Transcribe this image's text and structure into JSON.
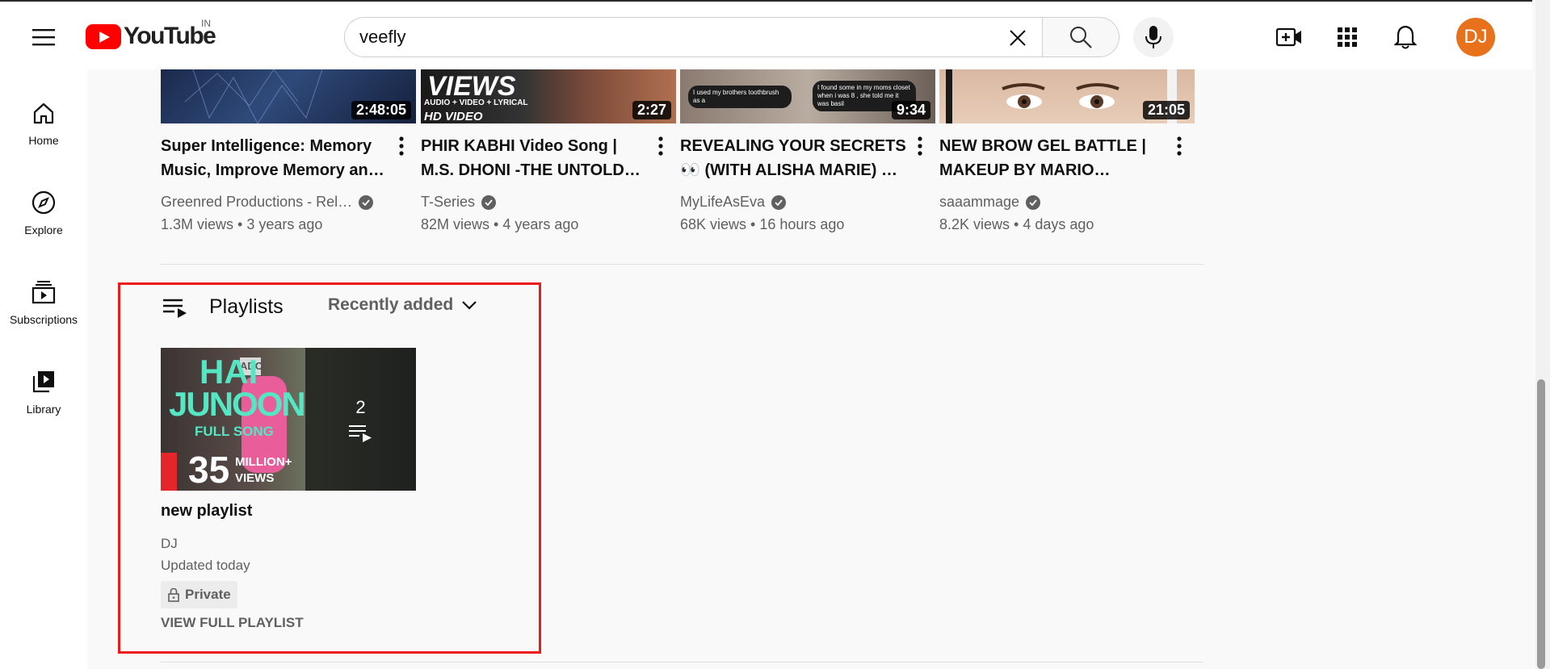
{
  "header": {
    "logo_text": "YouTube",
    "country_code": "IN",
    "search_value": "veefly",
    "avatar_initials": "DJ"
  },
  "guide": {
    "items": [
      {
        "label": "Home",
        "icon": "home-icon"
      },
      {
        "label": "Explore",
        "icon": "compass-icon"
      },
      {
        "label": "Subscriptions",
        "icon": "subscriptions-icon"
      },
      {
        "label": "Library",
        "icon": "library-icon"
      }
    ]
  },
  "videos": [
    {
      "duration": "2:48:05",
      "title_line1": "Super Intelligence: Memory",
      "title_line2": "Music, Improve Memory an…",
      "channel": "Greenred Productions - Rel…",
      "views": "1.3M views",
      "age": "3 years ago",
      "verified": true
    },
    {
      "duration": "2:27",
      "title_line1": "PHIR KABHI Video Song |",
      "title_line2": "M.S. DHONI -THE UNTOLD…",
      "channel": "T-Series",
      "views": "82M views",
      "age": "4 years ago",
      "verified": true,
      "thumb_text_1": "VIEWS",
      "thumb_text_2": "AUDIO + VIDEO + LYRICAL",
      "thumb_text_3": "HD VIDEO"
    },
    {
      "duration": "9:34",
      "title_line1": "REVEALING YOUR SECRETS",
      "title_line2": "👀 (WITH ALISHA MARIE) …",
      "channel": "MyLifeAsEva",
      "views": "68K views",
      "age": "16 hours ago",
      "verified": true,
      "thumb_text_1": "I used my brothers toothbrush as a",
      "thumb_text_2": "I found some        in my moms closet when i was 8 , she told me it was basil"
    },
    {
      "duration": "21:05",
      "title_line1": "NEW BROW GEL BATTLE |",
      "title_line2": "MAKEUP BY MARIO…",
      "channel": "saaammage",
      "views": "8.2K views",
      "age": "4 days ago",
      "verified": true
    }
  ],
  "playlists_shelf": {
    "title": "Playlists",
    "sort_label": "Recently added",
    "playlist": {
      "title": "new playlist",
      "video_count": "2",
      "owner": "DJ",
      "updated": "Updated today",
      "privacy": "Private",
      "view_full": "VIEW FULL PLAYLIST",
      "thumb_text_1": "HAI",
      "thumb_text_2": "JUNOON",
      "thumb_text_3": "FULL SONG",
      "thumb_text_4": "35",
      "thumb_text_5": "MILLION+",
      "thumb_text_6": "VIEWS",
      "thumb_text_7": "ADO"
    }
  },
  "colors": {
    "youtube_red": "#ff0000",
    "avatar_bg": "#e8711c",
    "highlight_border": "#ee1a1a"
  }
}
